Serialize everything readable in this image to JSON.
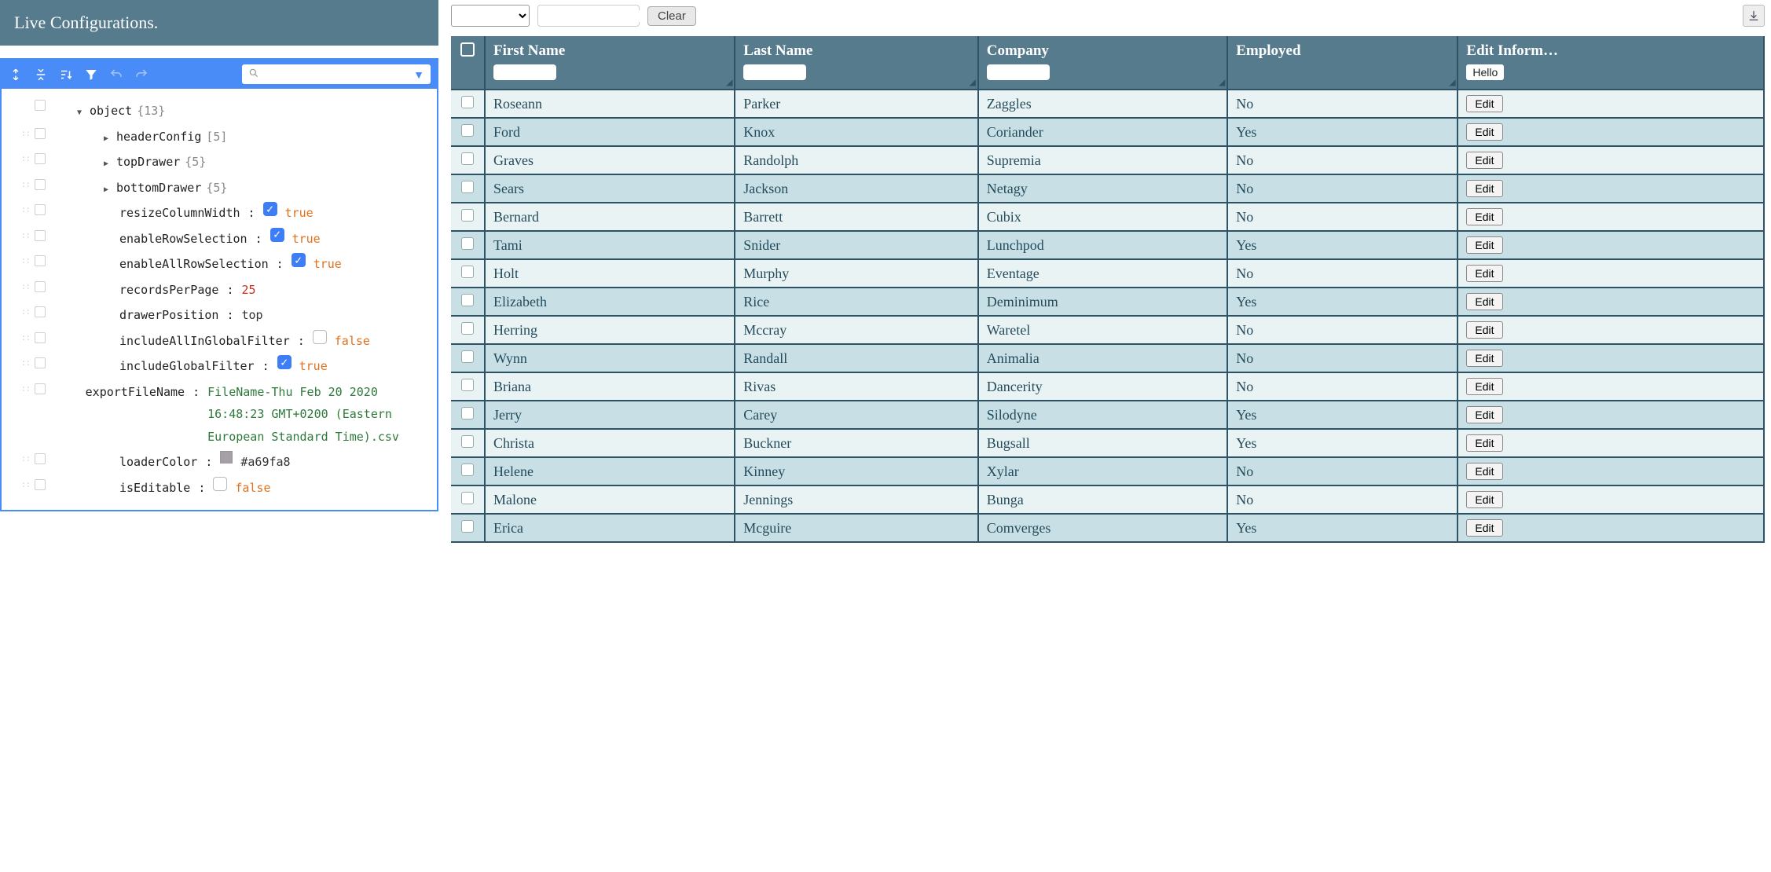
{
  "header": {
    "title": "Live Configurations."
  },
  "jsonEditor": {
    "root": {
      "key": "object",
      "count": "{13}"
    },
    "nodes": [
      {
        "type": "branch",
        "key": "headerConfig",
        "count": "[5]"
      },
      {
        "type": "branch",
        "key": "topDrawer",
        "count": "{5}"
      },
      {
        "type": "branch",
        "key": "bottomDrawer",
        "count": "{5}"
      },
      {
        "type": "bool",
        "key": "resizeColumnWidth",
        "value": "true",
        "checked": true
      },
      {
        "type": "bool",
        "key": "enableRowSelection",
        "value": "true",
        "checked": true
      },
      {
        "type": "bool",
        "key": "enableAllRowSelection",
        "value": "true",
        "checked": true
      },
      {
        "type": "num",
        "key": "recordsPerPage",
        "value": "25"
      },
      {
        "type": "plain",
        "key": "drawerPosition",
        "value": "top"
      },
      {
        "type": "bool",
        "key": "includeAllInGlobalFilter",
        "value": "false",
        "checked": false
      },
      {
        "type": "bool",
        "key": "includeGlobalFilter",
        "value": "true",
        "checked": true
      },
      {
        "type": "str",
        "key": "exportFileName",
        "value": "FileName-Thu Feb 20 2020 16:48:23 GMT+0200 (Eastern European Standard Time).csv"
      },
      {
        "type": "color",
        "key": "loaderColor",
        "value": "#a69fa8",
        "swatch": "#a69fa8"
      },
      {
        "type": "bool",
        "key": "isEditable",
        "value": "false",
        "checked": false
      }
    ]
  },
  "toolbar": {
    "clear_label": "Clear"
  },
  "table": {
    "columns": {
      "first_name": "First Name",
      "last_name": "Last Name",
      "company": "Company",
      "employed": "Employed",
      "edit_info": "Edit Inform…"
    },
    "edit_column_badge": "Hello",
    "edit_button_label": "Edit",
    "rows": [
      {
        "first": "Roseann",
        "last": "Parker",
        "company": "Zaggles",
        "employed": "No"
      },
      {
        "first": "Ford",
        "last": "Knox",
        "company": "Coriander",
        "employed": "Yes"
      },
      {
        "first": "Graves",
        "last": "Randolph",
        "company": "Supremia",
        "employed": "No"
      },
      {
        "first": "Sears",
        "last": "Jackson",
        "company": "Netagy",
        "employed": "No"
      },
      {
        "first": "Bernard",
        "last": "Barrett",
        "company": "Cubix",
        "employed": "No"
      },
      {
        "first": "Tami",
        "last": "Snider",
        "company": "Lunchpod",
        "employed": "Yes"
      },
      {
        "first": "Holt",
        "last": "Murphy",
        "company": "Eventage",
        "employed": "No"
      },
      {
        "first": "Elizabeth",
        "last": "Rice",
        "company": "Deminimum",
        "employed": "Yes"
      },
      {
        "first": "Herring",
        "last": "Mccray",
        "company": "Waretel",
        "employed": "No"
      },
      {
        "first": "Wynn",
        "last": "Randall",
        "company": "Animalia",
        "employed": "No"
      },
      {
        "first": "Briana",
        "last": "Rivas",
        "company": "Dancerity",
        "employed": "No"
      },
      {
        "first": "Jerry",
        "last": "Carey",
        "company": "Silodyne",
        "employed": "Yes"
      },
      {
        "first": "Christa",
        "last": "Buckner",
        "company": "Bugsall",
        "employed": "Yes"
      },
      {
        "first": "Helene",
        "last": "Kinney",
        "company": "Xylar",
        "employed": "No"
      },
      {
        "first": "Malone",
        "last": "Jennings",
        "company": "Bunga",
        "employed": "No"
      },
      {
        "first": "Erica",
        "last": "Mcguire",
        "company": "Comverges",
        "employed": "Yes"
      }
    ]
  }
}
